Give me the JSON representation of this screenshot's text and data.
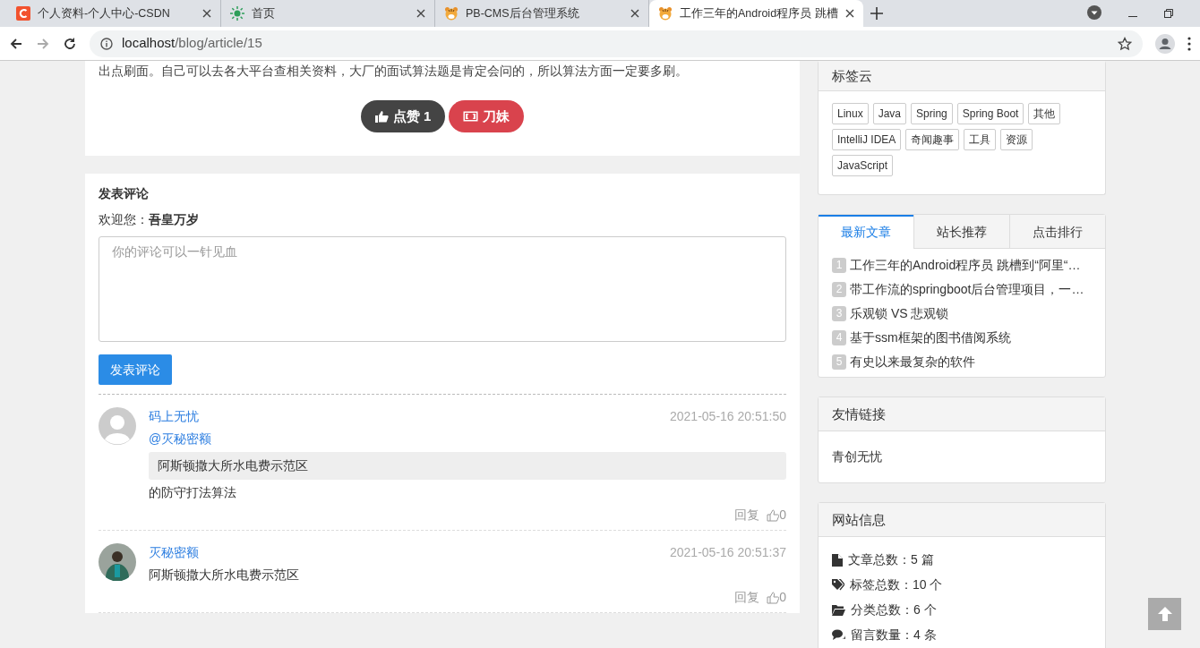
{
  "browser": {
    "tabs": [
      {
        "title": "个人资料-个人中心-CSDN",
        "kind": "csdn",
        "selected": false
      },
      {
        "title": "首页",
        "kind": "sun",
        "selected": false
      },
      {
        "title": "PB-CMS后台管理系统",
        "kind": "tiger",
        "selected": false
      },
      {
        "title": "工作三年的Android程序员 跳槽",
        "kind": "tiger",
        "selected": true
      }
    ],
    "url_host": "localhost",
    "url_path": "/blog/article/15"
  },
  "article": {
    "excerpt": "出点刷面。自己可以去各大平台查相关资料，大厂的面试算法题是肯定会问的，所以算法方面一定要多刷。",
    "like_label": "点赞 1",
    "reward_label": "刀妹"
  },
  "comment_form": {
    "title": "发表评论",
    "welcome": "欢迎您：",
    "username": "吾皇万岁",
    "placeholder": "你的评论可以一针见血",
    "submit": "发表评论"
  },
  "comments": [
    {
      "author": "码上无忧",
      "kind": "blank",
      "time": "2021-05-16 20:51:50",
      "reply_to": "@灭秘密额",
      "quote": "阿斯顿撒大所水电费示范区",
      "text": "的防守打法算法",
      "reply": "回复",
      "likes": "0"
    },
    {
      "author": "灭秘密额",
      "kind": "figure",
      "time": "2021-05-16 20:51:37",
      "text": "阿斯顿撒大所水电费示范区",
      "reply": "回复",
      "likes": "0"
    }
  ],
  "sidebar": {
    "tag_cloud": {
      "title": "标签云",
      "tags": [
        "Linux",
        "Java",
        "Spring",
        "Spring Boot",
        "其他",
        "IntelliJ IDEA",
        "奇闻趣事",
        "工具",
        "资源",
        "JavaScript"
      ]
    },
    "article_tabs": {
      "tabs": [
        {
          "label": "最新文章",
          "selected": true
        },
        {
          "label": "站长推荐",
          "selected": false
        },
        {
          "label": "点击排行",
          "selected": false
        }
      ],
      "items": [
        {
          "rank": "1",
          "title": "工作三年的Android程序员 跳槽到“阿里“…"
        },
        {
          "rank": "2",
          "title": "带工作流的springboot后台管理项目，一…"
        },
        {
          "rank": "3",
          "title": "乐观锁 VS 悲观锁"
        },
        {
          "rank": "4",
          "title": "基于ssm框架的图书借阅系统"
        },
        {
          "rank": "5",
          "title": "有史以来最复杂的软件"
        }
      ]
    },
    "links": {
      "title": "友情链接",
      "items": [
        "青创无忧"
      ]
    },
    "site_info": {
      "title": "网站信息",
      "stats": [
        {
          "kind": "file",
          "text": "文章总数：5 篇"
        },
        {
          "kind": "tags",
          "text": "标签总数：10 个"
        },
        {
          "kind": "folder",
          "text": "分类总数：6 个"
        },
        {
          "kind": "chat",
          "text": "留言数量：4 条"
        }
      ]
    }
  }
}
